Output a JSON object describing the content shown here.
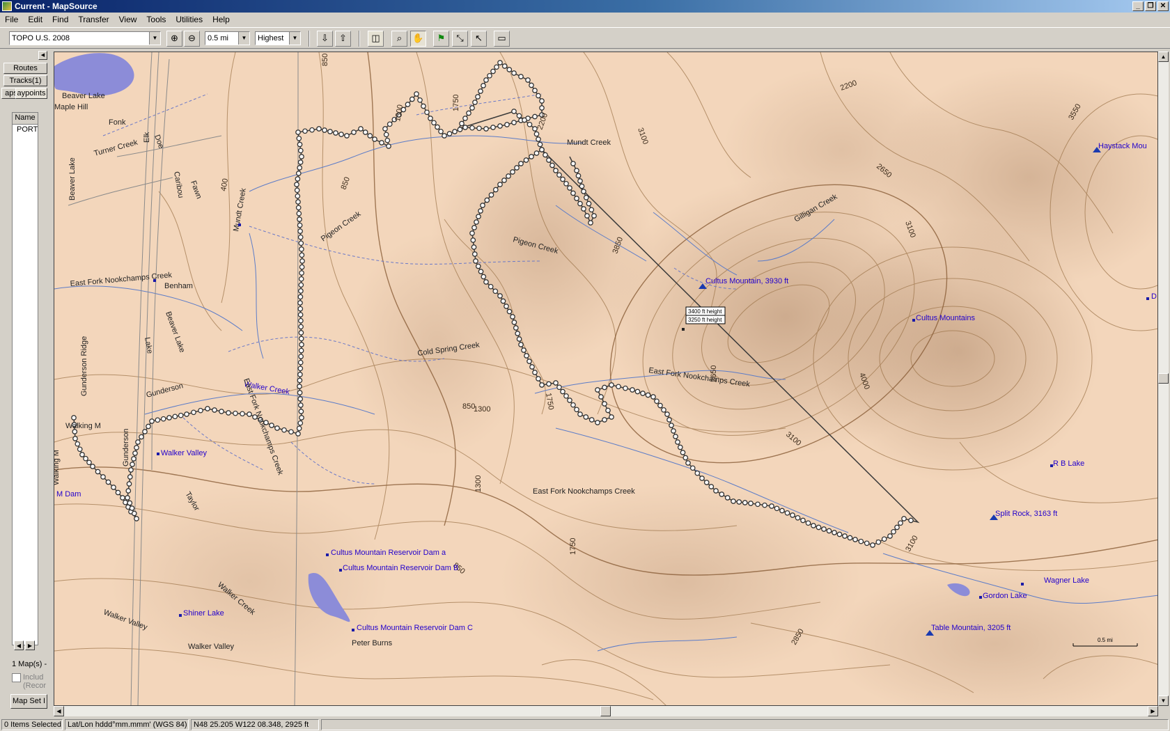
{
  "window": {
    "title": "Current - MapSource",
    "controls": [
      "_",
      "❐",
      "✕"
    ]
  },
  "menu": [
    "File",
    "Edit",
    "Find",
    "Transfer",
    "View",
    "Tools",
    "Utilities",
    "Help"
  ],
  "toolbar": {
    "map_product": "TOPO U.S. 2008",
    "zoom_scale": "0.5 mi",
    "detail_level": "Highest"
  },
  "sidebar": {
    "tabs": [
      "Routes",
      "Tracks(1)",
      "aps",
      "aypoints"
    ],
    "list_header": "Name",
    "list_items": [
      "PORT"
    ],
    "maps_count": "1 Map(s) -",
    "include_checkbox": {
      "label": "Includ",
      "sublabel": "(Recor",
      "checked": false
    },
    "mapset_button": "Map Set I"
  },
  "map": {
    "places": [
      "Beaver Lake",
      "Maple Hill",
      "Fonk",
      "Turner Creek",
      "Elk",
      "Doe",
      "Beaver Lake",
      "Caribou",
      "Fawn",
      "Mundt Creek",
      "Pigeon Creek",
      "Mundt Creek",
      "Pigeon Creek",
      "East Fork Nookchamps Creek",
      "Benham",
      "Beaver Lake",
      "Lake",
      "Gunderson Ridge",
      "Gunderson",
      "Walker Creek",
      "East Fork Nookchamps Creek",
      "Walking M",
      "Gunderson",
      "Walker Valley",
      "Walking M",
      "M Dam",
      "Taylor",
      "Cold Spring Creek",
      "East Fork Nookchamps Creek",
      "East Fork Nookchamps Creek",
      "Gilligan Creek",
      "Cultus Mountain, 3930 ft",
      "Cultus Mountains",
      "Haystack Mou",
      "R B Lake",
      "Split Rock, 3163 ft",
      "Wagner Lake",
      "Gordon Lake",
      "Table Mountain, 3205 ft",
      "Cultus Mountain Reservoir Dam a",
      "Cultus Mountain Reservoir Dam B",
      "Cultus Mountain Reservoir Dam C",
      "Peter Burns",
      "Walker Creek",
      "Walker Valley",
      "Shiner Lake",
      "Walker Valley",
      "D"
    ],
    "contours": [
      "850",
      "850",
      "1750",
      "1300",
      "400",
      "850",
      "2200",
      "3100",
      "2200",
      "3850",
      "2650",
      "3100",
      "3550",
      "2650",
      "4000",
      "1300",
      "1750",
      "1300",
      "3100",
      "1750",
      "3100",
      "850",
      "2850"
    ],
    "tooltip": [
      "3400 ft height",
      "3250 ft height"
    ],
    "scale_label": "0.5 mi",
    "colors": {
      "terrain": "#f3d6bb",
      "contour": "#a0784e",
      "water": "#8c8cd8",
      "track": "#3a3a3a",
      "label": "#2200cc"
    },
    "icons": [
      "summit-icon",
      "waypoint-icon"
    ]
  },
  "status": {
    "selection": "0 Items Selected",
    "format": "Lat/Lon hddd°mm.mmm' (WGS 84)",
    "position": "N48 25.205 W122 08.348, 2925 ft"
  }
}
